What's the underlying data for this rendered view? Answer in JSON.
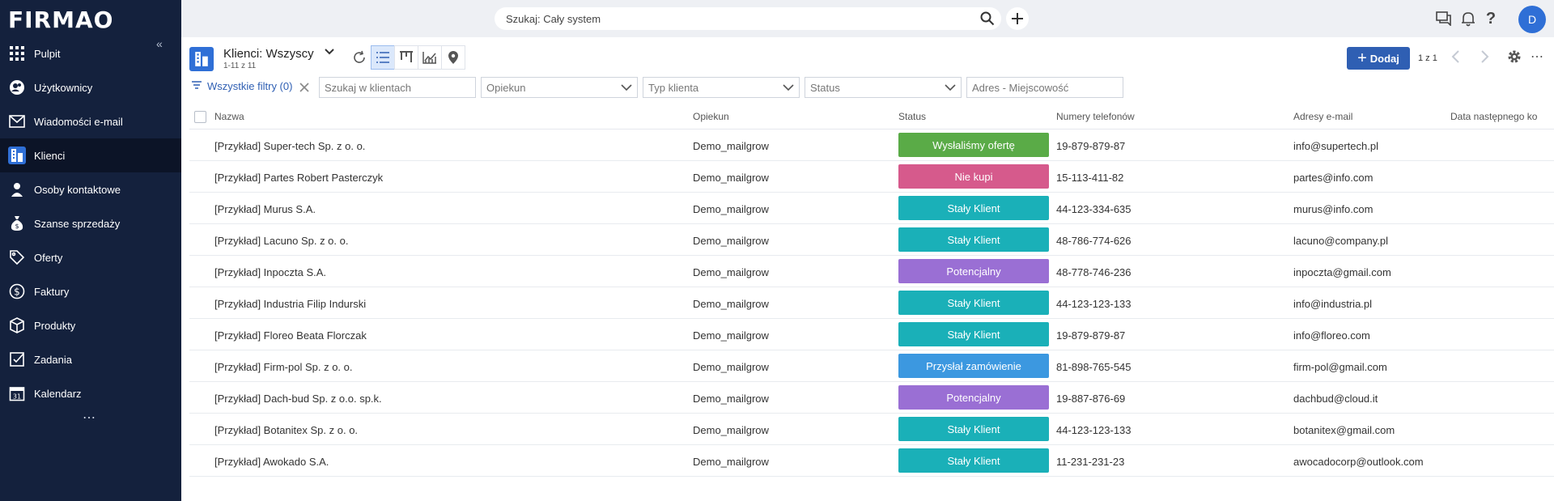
{
  "app": {
    "logo": "FIRMAO",
    "more": "⋯"
  },
  "sidebar": {
    "items": [
      {
        "label": "Pulpit",
        "icon": "grid-icon"
      },
      {
        "label": "Użytkownicy",
        "icon": "users-icon"
      },
      {
        "label": "Wiadomości e-mail",
        "icon": "mail-icon"
      },
      {
        "label": "Klienci",
        "icon": "building-icon",
        "active": true
      },
      {
        "label": "Osoby kontaktowe",
        "icon": "person-icon"
      },
      {
        "label": "Szanse sprzedaży",
        "icon": "moneybag-icon"
      },
      {
        "label": "Oferty",
        "icon": "tag-icon"
      },
      {
        "label": "Faktury",
        "icon": "dollar-icon"
      },
      {
        "label": "Produkty",
        "icon": "box-icon"
      },
      {
        "label": "Zadania",
        "icon": "checkbox-icon"
      },
      {
        "label": "Kalendarz",
        "icon": "calendar-icon"
      }
    ]
  },
  "topbar": {
    "search_placeholder": "Szukaj: Cały system",
    "avatar": "D"
  },
  "view": {
    "title": "Klienci: Wszyscy",
    "subtitle": "1-11 z 11",
    "add_label": "Dodaj",
    "pager": "1 z 1"
  },
  "filters": {
    "all_label": "Wszystkie filtry (0)",
    "search_placeholder": "Szukaj w klientach",
    "opiekun": "Opiekun",
    "typ": "Typ klienta",
    "status": "Status",
    "adres": "Adres - Miejscowość"
  },
  "table": {
    "headers": {
      "name": "Nazwa",
      "opiekun": "Opiekun",
      "status": "Status",
      "phones": "Numery telefonów",
      "emails": "Adresy e-mail",
      "next_date": "Data następnego ko"
    },
    "rows": [
      {
        "name": "[Przykład] Super-tech Sp. z o. o.",
        "opiekun": "Demo_mailgrow",
        "status": "Wysłaliśmy ofertę",
        "phone": "19-879-879-87",
        "email": "info@supertech.pl"
      },
      {
        "name": "[Przykład] Partes Robert Pasterczyk",
        "opiekun": "Demo_mailgrow",
        "status": "Nie kupi",
        "phone": "15-113-411-82",
        "email": "partes@info.com"
      },
      {
        "name": "[Przykład] Murus S.A.",
        "opiekun": "Demo_mailgrow",
        "status": "Stały Klient",
        "phone": "44-123-334-635",
        "email": "murus@info.com"
      },
      {
        "name": "[Przykład] Lacuno Sp. z o. o.",
        "opiekun": "Demo_mailgrow",
        "status": "Stały Klient",
        "phone": "48-786-774-626",
        "email": "lacuno@company.pl"
      },
      {
        "name": "[Przykład] Inpoczta S.A.",
        "opiekun": "Demo_mailgrow",
        "status": "Potencjalny",
        "phone": "48-778-746-236",
        "email": "inpoczta@gmail.com"
      },
      {
        "name": "[Przykład] Industria Filip Indurski",
        "opiekun": "Demo_mailgrow",
        "status": "Stały Klient",
        "phone": "44-123-123-133",
        "email": "info@industria.pl"
      },
      {
        "name": "[Przykład] Floreo Beata Florczak",
        "opiekun": "Demo_mailgrow",
        "status": "Stały Klient",
        "phone": "19-879-879-87",
        "email": "info@floreo.com"
      },
      {
        "name": "[Przykład] Firm-pol Sp. z o. o.",
        "opiekun": "Demo_mailgrow",
        "status": "Przysłał zamówienie",
        "phone": "81-898-765-545",
        "email": "firm-pol@gmail.com"
      },
      {
        "name": "[Przykład] Dach-bud Sp. z o.o. sp.k.",
        "opiekun": "Demo_mailgrow",
        "status": "Potencjalny",
        "phone": "19-887-876-69",
        "email": "dachbud@cloud.it"
      },
      {
        "name": "[Przykład] Botanitex Sp. z o. o.",
        "opiekun": "Demo_mailgrow",
        "status": "Stały Klient",
        "phone": "44-123-123-133",
        "email": "botanitex@gmail.com"
      },
      {
        "name": "[Przykład] Awokado S.A.",
        "opiekun": "Demo_mailgrow",
        "status": "Stały Klient",
        "phone": "11-231-231-23",
        "email": "awocadocorp@outlook.com"
      }
    ]
  },
  "status_colors": {
    "Wysłaliśmy ofertę": "#5aab47",
    "Nie kupi": "#d65a8c",
    "Stały Klient": "#1ab0b8",
    "Potencjalny": "#9a6fd4",
    "Przysłał zamówienie": "#3c98e0"
  }
}
